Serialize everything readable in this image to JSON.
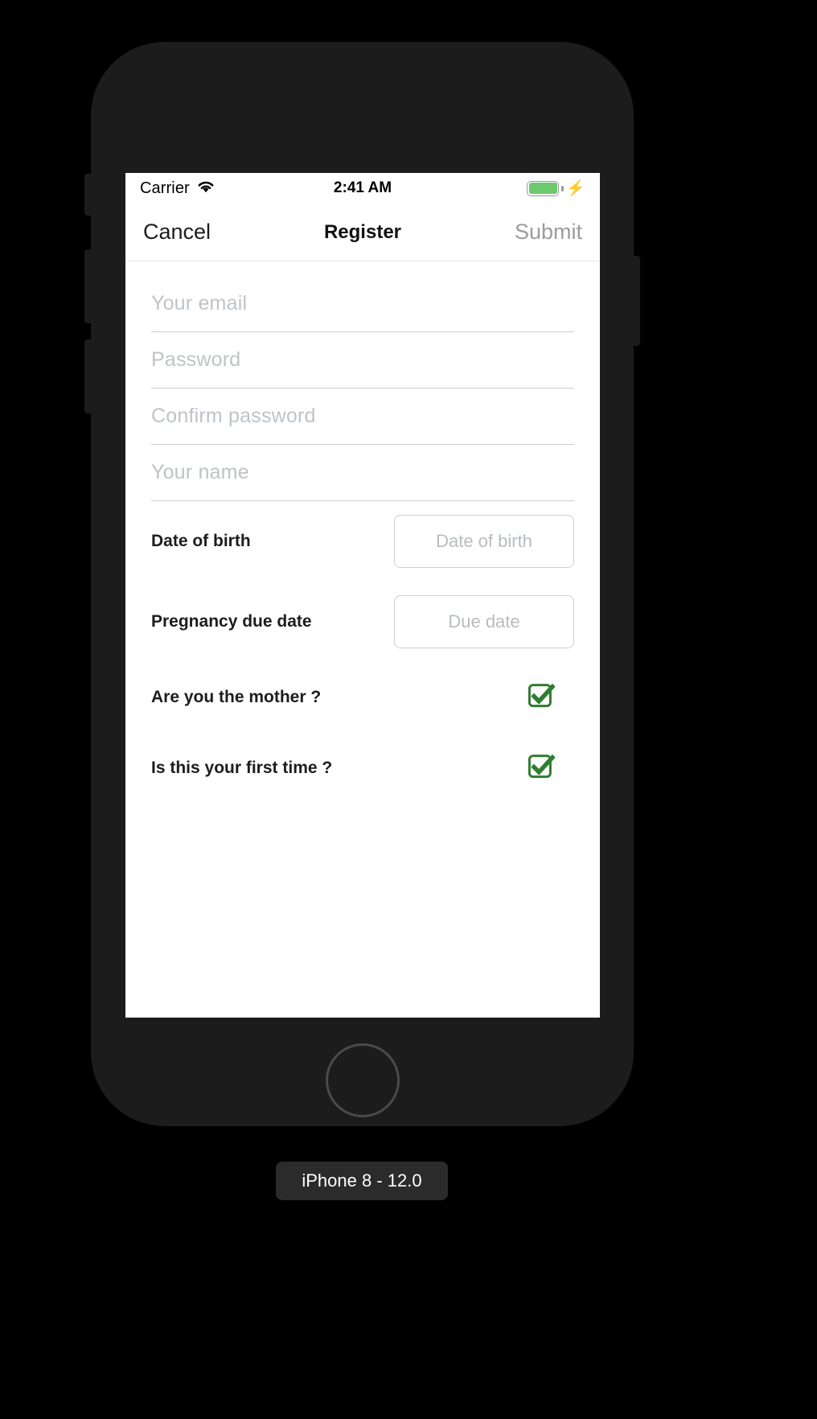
{
  "status_bar": {
    "carrier": "Carrier",
    "wifi_icon": "wifi-icon",
    "time": "2:41 AM",
    "battery_icon": "battery-icon",
    "charging_icon": "lightning-bolt-icon",
    "battery_color": "#6dc96d"
  },
  "nav_bar": {
    "cancel_label": "Cancel",
    "title": "Register",
    "submit_label": "Submit",
    "submit_color": "#9c9c9c"
  },
  "form": {
    "fields": [
      {
        "name": "email",
        "placeholder": "Your email",
        "value": ""
      },
      {
        "name": "password",
        "placeholder": "Password",
        "value": ""
      },
      {
        "name": "confirm-password",
        "placeholder": "Confirm password",
        "value": ""
      },
      {
        "name": "full-name",
        "placeholder": "Your name",
        "value": ""
      }
    ],
    "date_rows": [
      {
        "label": "Date of birth",
        "placeholder": "Date of birth",
        "value": ""
      },
      {
        "label": "Pregnancy due date",
        "placeholder": "Due date",
        "value": ""
      }
    ],
    "check_rows": [
      {
        "label": "Are you the mother ?",
        "checked": true,
        "icon": "checkbox-checked-icon"
      },
      {
        "label": "Is this your first time ?",
        "checked": true,
        "icon": "checkbox-checked-icon"
      }
    ],
    "checkbox_color": "#2f7d31"
  },
  "caption": {
    "device_label": "iPhone 8 - 12.0"
  }
}
